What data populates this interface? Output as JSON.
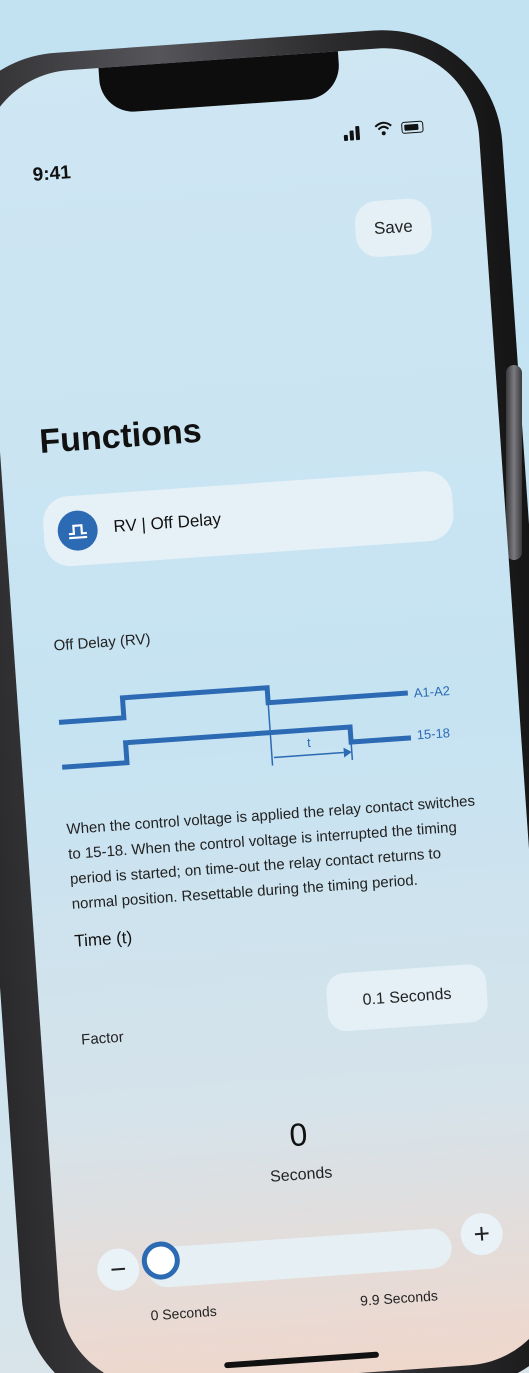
{
  "status": {
    "time": "9:41"
  },
  "header": {
    "save_label": "Save"
  },
  "page": {
    "title": "Functions"
  },
  "function_selector": {
    "label": "RV | Off Delay",
    "icon": "pulse-icon"
  },
  "diagram": {
    "title": "Off Delay (RV)",
    "series": [
      "A1-A2",
      "15-18"
    ],
    "time_marker": "t",
    "colors": {
      "line": "#2c6ab4"
    }
  },
  "description": "When the control voltage is applied the relay contact switches to 15-18. When the control voltage is interrupted the timing period is started; on time-out the relay contact returns to normal position. Resettable during the timing period.",
  "time": {
    "label": "Time (t)",
    "factor_label": "Factor",
    "factor_value": "0.1 Seconds",
    "value": "0",
    "unit": "Seconds",
    "slider": {
      "min_label": "0 Seconds",
      "max_label": "9.9 Seconds",
      "value_fraction": 0,
      "minus": "−",
      "plus": "+"
    }
  },
  "colors": {
    "accent": "#2c6ab4"
  }
}
